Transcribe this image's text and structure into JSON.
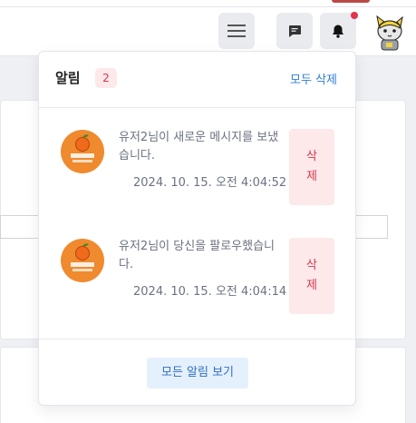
{
  "nav": {
    "menu_icon": "hamburger-icon",
    "chat_icon": "chat-icon",
    "bell_icon": "bell-icon",
    "avatar_icon": "cat-avatar"
  },
  "notifications": {
    "title": "알림",
    "count": "2",
    "clear_all": "모두 삭제",
    "items": [
      {
        "message": "유저2님이 새로운 메시지를 보냈습니다.",
        "time": "2024. 10. 15. 오전 4:04:52",
        "delete_label": "삭제"
      },
      {
        "message": "유저2님이 당신을 팔로우했습니다.",
        "time": "2024. 10. 15. 오전 4:04:14",
        "delete_label": "삭제"
      }
    ],
    "view_all": "모든 알림 보기"
  },
  "colors": {
    "accent_blue": "#2f7ed8",
    "danger_red": "#d23c4f",
    "danger_bg": "#fde8ea",
    "avatar_orange": "#ef8a2e"
  }
}
